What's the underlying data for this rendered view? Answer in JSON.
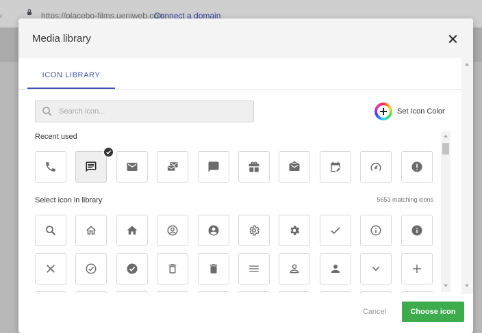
{
  "browser": {
    "back_glyph": "«",
    "url": "https://placebo-films.ueniweb.com",
    "connect_link": "Connect a domain"
  },
  "modal": {
    "title": "Media library",
    "tab_label": "ICON LIBRARY",
    "search_placeholder": "Search icon...",
    "set_color_label": "Set Icon Color",
    "recent_label": "Recent used",
    "library_label": "Select icon in library",
    "match_count": "5653 matching icons",
    "cancel_label": "Cancel",
    "choose_label": "Choose icon"
  },
  "recent_icons": [
    "phone",
    "chat-message",
    "email",
    "email-stack",
    "chat-bubble",
    "gift",
    "drafts-mail",
    "calendar-edit",
    "speed-meter",
    "exclamation"
  ],
  "selected_recent": "chat-message",
  "library_icons": [
    [
      "search",
      "home-outline",
      "home",
      "account-circle-outline",
      "account-circle",
      "settings-outline",
      "settings",
      "check",
      "info-outline",
      "info"
    ],
    [
      "close",
      "check-circle-outline",
      "check-circle",
      "delete-outline",
      "delete",
      "menu",
      "person-outline",
      "person",
      "chevron-down",
      "plus"
    ]
  ],
  "colors": {
    "icon": "#6b6b6b",
    "accent": "#3f51b5",
    "primary_button": "#3dac4c"
  }
}
